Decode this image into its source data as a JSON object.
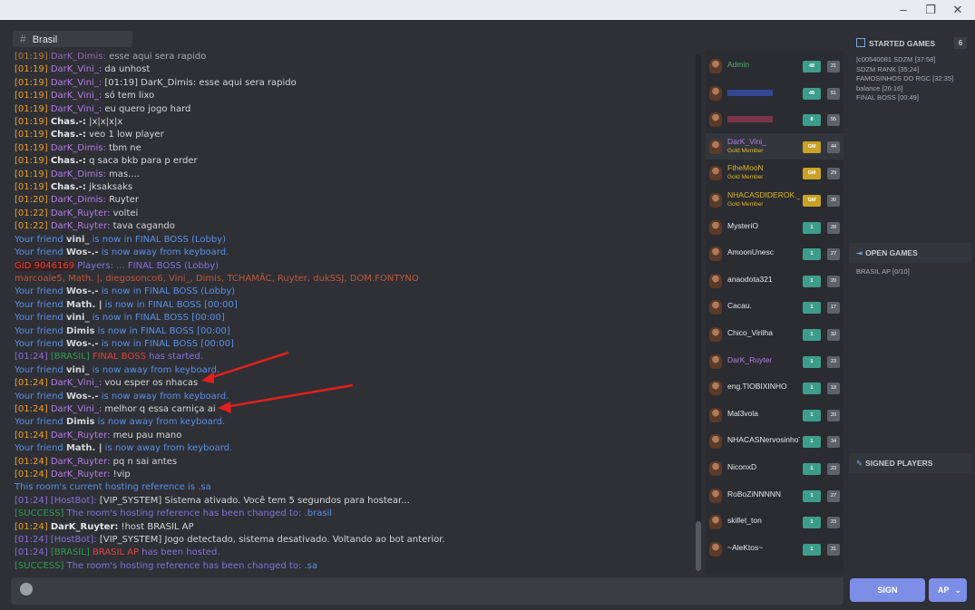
{
  "window": {
    "minimize": "–",
    "maximize": "❐",
    "close": "✕"
  },
  "channel": {
    "hash": "#",
    "name": "Brasil"
  },
  "chat_lines": [
    {
      "ts": "[01:19]",
      "name": "DarK_Dimis:",
      "text": " esse aqui sera rapido",
      "faded": true
    },
    {
      "ts": "[01:19]",
      "name": "DarK_Vini_:",
      "text": " da unhost"
    },
    {
      "ts": "[01:19]",
      "name": "DarK_Vini_:",
      "text": " [01:19] DarK_Dimis: esse aqui sera rapido"
    },
    {
      "ts": "[01:19]",
      "name": "DarK_Vini_:",
      "text": " só tem lixo"
    },
    {
      "ts": "[01:19]",
      "name": "DarK_Vini_:",
      "text": " eu quero jogo hard"
    },
    {
      "ts": "[01:19]",
      "wname": "Chas.-:",
      "text": " |x|x|x|x"
    },
    {
      "ts": "[01:19]",
      "wname": "Chas.-:",
      "text": " veo 1 low player"
    },
    {
      "ts": "[01:19]",
      "name": "DarK_Dimis:",
      "text": " tbm ne"
    },
    {
      "ts": "[01:19]",
      "wname": "Chas.-:",
      "text": " q saca bkb para p erder"
    },
    {
      "ts": "[01:19]",
      "name": "DarK_Dimis:",
      "text": " mas...."
    },
    {
      "ts": "[01:19]",
      "wname": "Chas.-:",
      "text": " jksaksaks"
    },
    {
      "ts": "[01:20]",
      "name": "DarK_Dimis:",
      "text": " Ruyter"
    },
    {
      "ts": "[01:22]",
      "name": "DarK_Ruyter:",
      "text": " voltei"
    },
    {
      "ts": "[01:22]",
      "name": "DarK_Ruyter:",
      "text": " tava cagando"
    },
    {
      "friend": "Your friend ",
      "fname": "vini_",
      "ftext": " is now in FINAL BOSS (Lobby)"
    },
    {
      "friend": "Your friend ",
      "fname": "Wos-.-",
      "ftext": " is now away from keyboard."
    },
    {
      "gid": "GID 9046169",
      "gidtext": "  Players: ... FINAL BOSS (Lobby)",
      "special": "gid"
    },
    {
      "orange_list": "marcoale5, Math. |, diegosonco6, Vini_, Dimis, TCHAMÃC, Ruyter, dukSSJ, DOM.FONTYNO"
    },
    {
      "friend": "Your friend ",
      "fname": "Wos-.-",
      "ftext": " is now in FINAL BOSS (Lobby)"
    },
    {
      "friend": "Your friend ",
      "fname": "Math. |",
      "ftext": " is now in FINAL BOSS [00:00]"
    },
    {
      "friend": "Your friend ",
      "fname": "vini_",
      "ftext": " is now in FINAL BOSS [00:00]"
    },
    {
      "friend": "Your friend ",
      "fname": "Dimis",
      "ftext": " is now in FINAL BOSS [00:00]"
    },
    {
      "friend": "Your friend ",
      "fname": "Wos-.-",
      "ftext": " is now in FINAL BOSS [00:00]"
    },
    {
      "ts": "[01:24]",
      "green": "[BRASIL]",
      "red": " FINAL BOSS",
      "plain": " has started."
    },
    {
      "friend": "Your friend ",
      "fname": "vini_",
      "ftext": " is now away from keyboard."
    },
    {
      "ts": "[01:24]",
      "name": "DarK_Vini_:",
      "text": " vou esper os nhacas",
      "orange_ts": true
    },
    {
      "friend": "Your friend ",
      "fname": "Wos-.-",
      "ftext": " is now away from keyboard."
    },
    {
      "ts": "[01:24]",
      "name": "DarK_Vini_:",
      "text": " melhor q essa carniça ai",
      "orange_ts": true
    },
    {
      "friend": "Your friend ",
      "fname": "Dimis",
      "ftext": " is now away from keyboard."
    },
    {
      "ts": "[01:24]",
      "name": "DarK_Ruyter:",
      "text": " meu pau mano"
    },
    {
      "friend": "Your friend ",
      "fname": "Math. |",
      "ftext": " is now away from keyboard."
    },
    {
      "ts": "[01:24]",
      "name": "DarK_Ruyter:",
      "text": " pq n sai antes"
    },
    {
      "ts": "[01:24]",
      "name": "DarK_Ruyter:",
      "text": " !vip"
    },
    {
      "info": "This room's current hosting reference is .sa"
    },
    {
      "ts": "[01:24]",
      "host": "[HostBot]:",
      "text": " [VIP_SYSTEM] Sistema ativado. Você tem 5 segundos para hostear..."
    },
    {
      "success": "[SUCCESS]",
      "stext": " The room's hosting reference has been changed to: ",
      "sval": ".brasil"
    },
    {
      "ts": "[01:24]",
      "wname": "DarK_Ruyter:",
      "text": " !host BRASIL AP"
    },
    {
      "ts": "[01:24]",
      "host": "[HostBot]:",
      "text": " [VIP_SYSTEM] Jogo detectado, sistema desativado. Voltando ao bot anterior."
    },
    {
      "ts": "[01:24]",
      "green": "[BRASIL]",
      "red": " BRASIL AP",
      "plain": " has been hosted."
    },
    {
      "success": "[SUCCESS]",
      "stext": " The room's hosting reference has been changed to: ",
      "sval": ".sa"
    }
  ],
  "players": [
    {
      "name": "Admin",
      "color": "#4fb06a",
      "badge": "48",
      "bcolor": "#3d9d8a",
      "count": "21"
    },
    {
      "name": "",
      "color": "#3b5bd6",
      "badge": "48",
      "bcolor": "#3d9d8a",
      "count": "51",
      "bar": "#3b5bd6"
    },
    {
      "name": "",
      "color": "#b23a5a",
      "badge": "8",
      "bcolor": "#3d9d8a",
      "count": "55",
      "bar": "#b23a5a"
    },
    {
      "name": "DarK_Vini_",
      "color": "#b77be6",
      "sub": "Gold Member",
      "badge": "GM",
      "bcolor": "#c9a226",
      "count": "44",
      "hl": true
    },
    {
      "name": "FtheMooN",
      "color": "#e0b72b",
      "sub": "Gold Member",
      "badge": "GM",
      "bcolor": "#c9a226",
      "count": "29"
    },
    {
      "name": "NHACASDIDEROK._.T",
      "color": "#e0b72b",
      "sub": "Gold Member",
      "badge": "GM",
      "bcolor": "#c9a226",
      "count": "30"
    },
    {
      "name": "MysteriO",
      "color": "#e6e7e9",
      "badge": "1",
      "bcolor": "#3d9d8a",
      "count": "28"
    },
    {
      "name": "AmoonUnesc",
      "color": "#e6e7e9",
      "badge": "1",
      "bcolor": "#3d9d8a",
      "count": "27"
    },
    {
      "name": "anaodota321",
      "color": "#e6e7e9",
      "badge": "1",
      "bcolor": "#3d9d8a",
      "count": "20"
    },
    {
      "name": "Cacau.",
      "color": "#e6e7e9",
      "badge": "1",
      "bcolor": "#3d9d8a",
      "count": "17"
    },
    {
      "name": "Chico_Virilha",
      "color": "#e6e7e9",
      "badge": "1",
      "bcolor": "#3d9d8a",
      "count": "32"
    },
    {
      "name": "DarK_Ruyter",
      "color": "#b77be6",
      "badge": "1",
      "bcolor": "#3d9d8a",
      "count": "23"
    },
    {
      "name": "eng.TIOBIXINHO",
      "color": "#e6e7e9",
      "badge": "1",
      "bcolor": "#3d9d8a",
      "count": "18"
    },
    {
      "name": "Mal3vola",
      "color": "#e6e7e9",
      "badge": "1",
      "bcolor": "#3d9d8a",
      "count": "20"
    },
    {
      "name": "NHACASNervosinhoT",
      "color": "#e6e7e9",
      "badge": "1",
      "bcolor": "#3d9d8a",
      "count": "34"
    },
    {
      "name": "NiconxD",
      "color": "#e6e7e9",
      "badge": "1",
      "bcolor": "#3d9d8a",
      "count": "23"
    },
    {
      "name": "RoBoZiNNNNN",
      "color": "#e6e7e9",
      "badge": "1",
      "bcolor": "#3d9d8a",
      "count": "27"
    },
    {
      "name": "skillet_ton",
      "color": "#e6e7e9",
      "badge": "1",
      "bcolor": "#3d9d8a",
      "count": "23"
    },
    {
      "name": "~AleKtos~",
      "color": "#e6e7e9",
      "badge": "1",
      "bcolor": "#3d9d8a",
      "count": "31"
    }
  ],
  "right": {
    "started_title": "STARTED GAMES",
    "started_count": "6",
    "started_games": [
      "|c00540081 SDZM [37:58]",
      "SDZM RANK [35:24]",
      "FAMOSINHOS DO RGC [32:35]",
      "balance [26:16]",
      "FINAL BOSS [00:49]"
    ],
    "open_title": "OPEN GAMES",
    "open_games": [
      "BRASIL AP [0/10]"
    ],
    "signed_title": "SIGNED PLAYERS"
  },
  "bottom": {
    "sign": "SIGN",
    "ap": "AP",
    "ap_arrow": "⌄"
  }
}
